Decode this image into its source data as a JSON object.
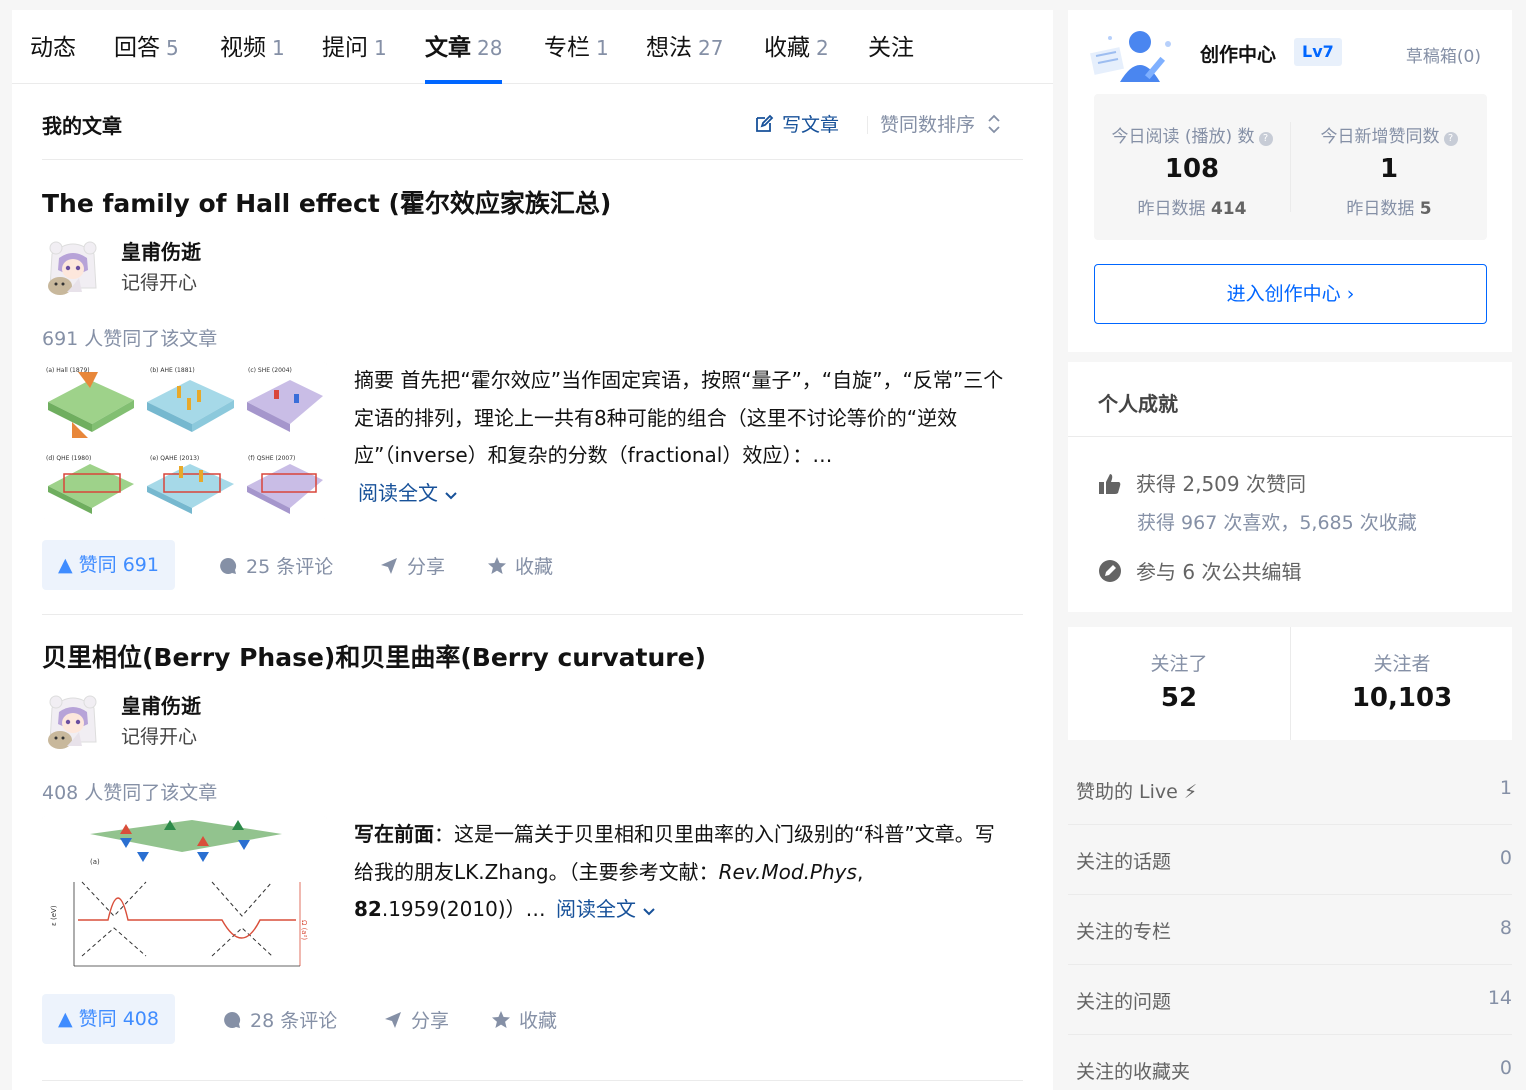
{
  "tabs": [
    {
      "label": "动态",
      "count": ""
    },
    {
      "label": "回答",
      "count": "5"
    },
    {
      "label": "视频",
      "count": "1"
    },
    {
      "label": "提问",
      "count": "1"
    },
    {
      "label": "文章",
      "count": "28"
    },
    {
      "label": "专栏",
      "count": "1"
    },
    {
      "label": "想法",
      "count": "27"
    },
    {
      "label": "收藏",
      "count": "2"
    },
    {
      "label": "关注",
      "count": ""
    }
  ],
  "active_tab": "文章",
  "section": {
    "title": "我的文章",
    "write_label": "写文章",
    "sort_label": "赞同数排序"
  },
  "articles": [
    {
      "title": "The family of Hall effect (霍尔效应家族汇总)",
      "author": "皇甫伤逝",
      "bio": "记得开心",
      "upvote_info": "691 人赞同了该文章",
      "excerpt": "摘要 首先把“霍尔效应”当作固定宾语，按照“量子”，“自旋”，“反常”三个定语的排列，理论上一共有8种可能的组合（这里不讨论等价的“逆效应”（inverse）和复杂的分数（fractional）效应）：…",
      "read_more": "阅读全文",
      "vote_label": "赞同 691",
      "comments_label": "25 条评论",
      "share_label": "分享",
      "fav_label": "收藏",
      "thumb_panels": [
        "(a) Hall (1879)",
        "(b) AHE (1881)",
        "(c) SHE (2004)",
        "(d) QHE (1980)",
        "(e) QAHE (2013)",
        "(f) QSHE (2007)"
      ]
    },
    {
      "title": "贝里相位(Berry Phase)和贝里曲率(Berry curvature)",
      "author": "皇甫伤逝",
      "bio": "记得开心",
      "upvote_info": "408 人赞同了该文章",
      "excerpt_bold": "写在前面",
      "excerpt_part1": "：这是一篇关于贝里相和贝里曲率的入门级别的“科普”文章。写给我的朋友LK.Zhang。（主要参考文献：",
      "excerpt_italic": "Rev.Mod.Phys",
      "excerpt_comma": ",",
      "excerpt_bold2": "82",
      "excerpt_part2": ".1959(2010)）…",
      "read_more": "阅读全文",
      "vote_label": "赞同 408",
      "comments_label": "28 条评论",
      "share_label": "分享",
      "fav_label": "收藏"
    }
  ],
  "creator": {
    "title": "创作中心",
    "level": "Lv7",
    "drafts": "草稿箱(0)",
    "reads_label": "今日阅读 (播放) 数",
    "reads_value": "108",
    "reads_yd_label": "昨日数据",
    "reads_yd_value": "414",
    "likes_label": "今日新增赞同数",
    "likes_value": "1",
    "likes_yd_label": "昨日数据",
    "likes_yd_value": "5",
    "enter_label": "进入创作中心 ›"
  },
  "achievements": {
    "title": "个人成就",
    "upvotes": "获得 2,509 次赞同",
    "likes_favs": "获得 967 次喜欢，5,685 次收藏",
    "edits": "参与 6 次公共编辑"
  },
  "follow": {
    "following_label": "关注了",
    "following_value": "52",
    "followers_label": "关注者",
    "followers_value": "10,103"
  },
  "side_list": [
    {
      "label": "赞助的 Live ⚡",
      "value": "1"
    },
    {
      "label": "关注的话题",
      "value": "0"
    },
    {
      "label": "关注的专栏",
      "value": "8"
    },
    {
      "label": "关注的问题",
      "value": "14"
    },
    {
      "label": "关注的收藏夹",
      "value": "0"
    }
  ],
  "colors": {
    "accent": "#0066ff",
    "link": "#175199",
    "muted": "#8590a6"
  }
}
